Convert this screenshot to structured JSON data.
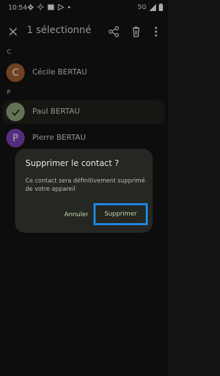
{
  "status_bar": {
    "time": "10:54",
    "network": "5G"
  },
  "header": {
    "title": "1 sélectionné"
  },
  "sections": [
    {
      "letter": "C",
      "contacts": [
        {
          "initial": "C",
          "name": "Cécile BERTAU",
          "color": "#a35d35"
        }
      ]
    },
    {
      "letter": "P",
      "contacts": [
        {
          "initial": "✓",
          "name": "Paul BERTAU",
          "color": "#8fa77a",
          "selected": true
        },
        {
          "initial": "P",
          "name": "Pierre BERTAU",
          "color": "#7b3fb4"
        }
      ]
    }
  ],
  "dialog": {
    "title": "Supprimer le contact ?",
    "body": "Ce contact sera définitivement supprimé de votre appareil",
    "cancel_label": "Annuler",
    "confirm_label": "Supprimer"
  },
  "colors": {
    "accent": "#c9d9a8",
    "highlight": "#1e88e5",
    "background": "#131313",
    "dialog": "#252722"
  }
}
